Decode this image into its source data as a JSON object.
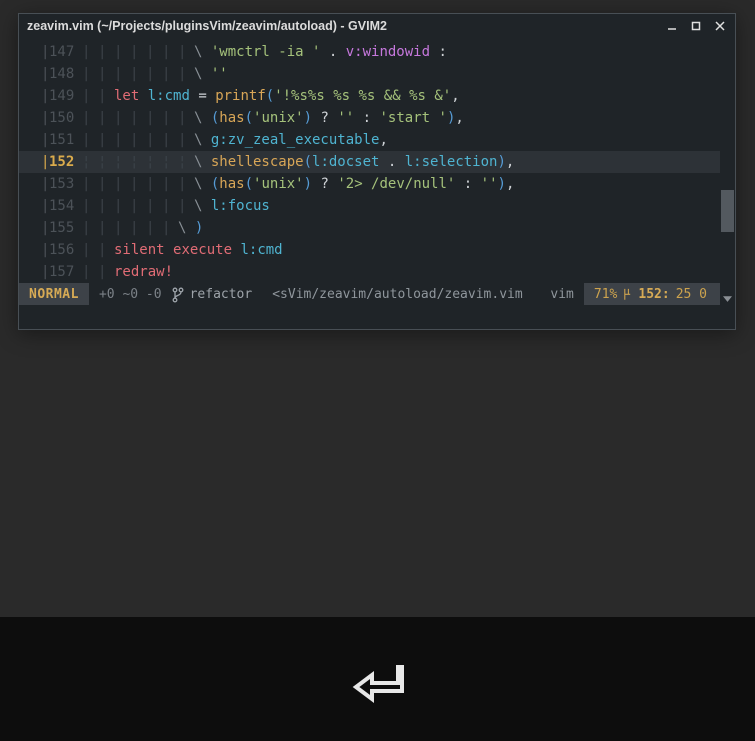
{
  "titlebar": {
    "title": "zeavim.vim (~/Projects/pluginsVim/zeavim/autoload) - GVIM2"
  },
  "lines": [
    {
      "num": "147",
      "current": false,
      "indent": 7,
      "tokens": [
        {
          "t": "cont",
          "v": "\\ "
        },
        {
          "t": "str",
          "v": "'wmctrl -ia '"
        },
        {
          "t": "op",
          "v": " . "
        },
        {
          "t": "vvar",
          "v": "v:windowid"
        },
        {
          "t": "op",
          "v": " :"
        }
      ]
    },
    {
      "num": "148",
      "current": false,
      "indent": 7,
      "tokens": [
        {
          "t": "cont",
          "v": "\\ "
        },
        {
          "t": "str",
          "v": "''"
        }
      ]
    },
    {
      "num": "149",
      "current": false,
      "indent": 2,
      "tokens": [
        {
          "t": "kw",
          "v": "let"
        },
        {
          "t": "op",
          "v": " "
        },
        {
          "t": "var",
          "v": "l:cmd"
        },
        {
          "t": "op",
          "v": " = "
        },
        {
          "t": "func",
          "v": "printf"
        },
        {
          "t": "paren",
          "v": "("
        },
        {
          "t": "str",
          "v": "'!%s%s %s %s && %s &'"
        },
        {
          "t": "punc",
          "v": ","
        }
      ]
    },
    {
      "num": "150",
      "current": false,
      "indent": 7,
      "tokens": [
        {
          "t": "cont",
          "v": "\\ "
        },
        {
          "t": "paren",
          "v": "("
        },
        {
          "t": "func",
          "v": "has"
        },
        {
          "t": "paren",
          "v": "("
        },
        {
          "t": "str",
          "v": "'unix'"
        },
        {
          "t": "paren",
          "v": ")"
        },
        {
          "t": "op",
          "v": " ? "
        },
        {
          "t": "str",
          "v": "''"
        },
        {
          "t": "op",
          "v": " : "
        },
        {
          "t": "str",
          "v": "'start '"
        },
        {
          "t": "paren",
          "v": ")"
        },
        {
          "t": "punc",
          "v": ","
        }
      ]
    },
    {
      "num": "151",
      "current": false,
      "indent": 7,
      "tokens": [
        {
          "t": "cont",
          "v": "\\ "
        },
        {
          "t": "var",
          "v": "g:zv_zeal_executable"
        },
        {
          "t": "punc",
          "v": ","
        }
      ]
    },
    {
      "num": "152",
      "current": true,
      "indent": 7,
      "tokens": [
        {
          "t": "cont",
          "v": "\\ "
        },
        {
          "t": "func",
          "v": "shellescape"
        },
        {
          "t": "paren",
          "v": "("
        },
        {
          "t": "var",
          "v": "l:docset"
        },
        {
          "t": "op",
          "v": " . "
        },
        {
          "t": "var",
          "v": "l:selection"
        },
        {
          "t": "paren",
          "v": ")"
        },
        {
          "t": "punc",
          "v": ","
        }
      ]
    },
    {
      "num": "153",
      "current": false,
      "indent": 7,
      "tokens": [
        {
          "t": "cont",
          "v": "\\ "
        },
        {
          "t": "paren",
          "v": "("
        },
        {
          "t": "func",
          "v": "has"
        },
        {
          "t": "paren",
          "v": "("
        },
        {
          "t": "str",
          "v": "'unix'"
        },
        {
          "t": "paren",
          "v": ")"
        },
        {
          "t": "op",
          "v": " ? "
        },
        {
          "t": "str",
          "v": "'2> /dev/null'"
        },
        {
          "t": "op",
          "v": " : "
        },
        {
          "t": "str",
          "v": "''"
        },
        {
          "t": "paren",
          "v": ")"
        },
        {
          "t": "punc",
          "v": ","
        }
      ]
    },
    {
      "num": "154",
      "current": false,
      "indent": 7,
      "tokens": [
        {
          "t": "cont",
          "v": "\\ "
        },
        {
          "t": "var",
          "v": "l:focus"
        }
      ]
    },
    {
      "num": "155",
      "current": false,
      "indent": 6,
      "tokens": [
        {
          "t": "cont",
          "v": "\\ "
        },
        {
          "t": "paren",
          "v": ")"
        }
      ]
    },
    {
      "num": "156",
      "current": false,
      "indent": 2,
      "tokens": [
        {
          "t": "kw",
          "v": "silent"
        },
        {
          "t": "op",
          "v": " "
        },
        {
          "t": "kw",
          "v": "execute"
        },
        {
          "t": "op",
          "v": " "
        },
        {
          "t": "var",
          "v": "l:cmd"
        }
      ]
    },
    {
      "num": "157",
      "current": false,
      "indent": 2,
      "tokens": [
        {
          "t": "kw",
          "v": "redraw"
        },
        {
          "t": "bang",
          "v": "!"
        }
      ]
    }
  ],
  "statusline": {
    "mode": "NORMAL",
    "mods": "+0 ~0 -0",
    "branch": "refactor",
    "file": "<sVim/zeavim/autoload/zeavim.vim",
    "filetype": "vim",
    "percent": "71%",
    "linenum": "152:",
    "col": "25 0"
  }
}
